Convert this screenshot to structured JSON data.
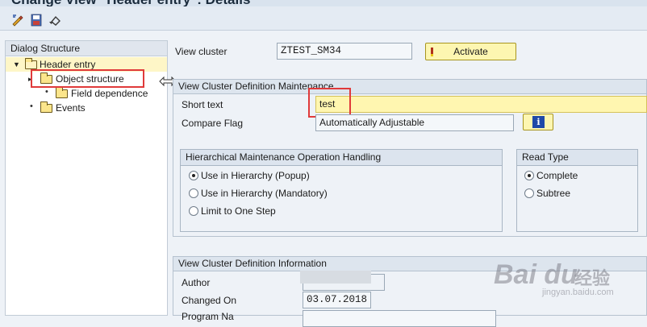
{
  "window": {
    "title": "Change View \"Header entry\": Details"
  },
  "toolbar": {
    "icons": [
      "edit-pencil-icon",
      "save-local-icon",
      "undo-icon"
    ]
  },
  "nav": {
    "header": "Dialog Structure",
    "items": [
      {
        "label": "Header entry",
        "level": 0,
        "expanded": true,
        "selected": true
      },
      {
        "label": "Object structure",
        "level": 1,
        "expanded": false,
        "selected": false
      },
      {
        "label": "Field dependence",
        "level": 2,
        "expanded": false,
        "selected": false
      },
      {
        "label": "Events",
        "level": 1,
        "expanded": false,
        "selected": false
      }
    ]
  },
  "top": {
    "view_cluster_label": "View cluster",
    "view_cluster_value": "ZTEST_SM34",
    "activate_label": "Activate"
  },
  "definition": {
    "title": "View Cluster Definition Maintenance",
    "short_text_label": "Short text",
    "short_text_value": "test",
    "compare_flag_label": "Compare Flag",
    "compare_flag_value": "Automatically Adjustable",
    "info_button_icon": "info-icon",
    "hier": {
      "title": "Hierarchical Maintenance Operation Handling",
      "options": [
        {
          "label": "Use in Hierarchy (Popup)",
          "selected": true
        },
        {
          "label": "Use in Hierarchy (Mandatory)",
          "selected": false
        },
        {
          "label": "Limit to One Step",
          "selected": false
        }
      ]
    },
    "read_type": {
      "title": "Read Type",
      "options": [
        {
          "label": "Complete",
          "selected": true
        },
        {
          "label": "Subtree",
          "selected": false
        }
      ]
    }
  },
  "information": {
    "title": "View Cluster Definition Information",
    "author_label": "Author",
    "changed_on_label": "Changed On",
    "changed_on_value": "03.07.2018",
    "third_label": "Program Na"
  },
  "watermark": {
    "logo": "Bai du",
    "cn": "经验",
    "url": "jingyan.baidu.com"
  },
  "colors": {
    "highlight": "#e03a3a",
    "button_yellow": "#fdf6b1",
    "selected_row": "#fef6c7",
    "input_yellow": "#fff6b0"
  }
}
